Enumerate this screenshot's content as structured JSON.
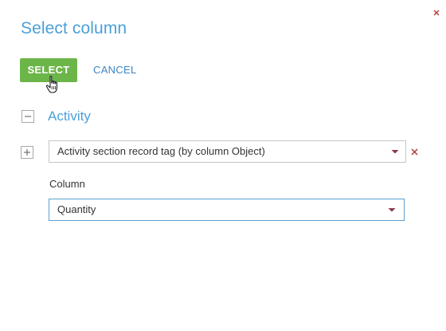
{
  "dialog": {
    "title": "Select column",
    "buttons": {
      "select_label": "SELECT",
      "cancel_label": "CANCEL"
    }
  },
  "group": {
    "label": "Activity",
    "collapse_icon": "minus-icon"
  },
  "lookup": {
    "expand_icon": "plus-icon",
    "value": "Activity section record tag (by column Object)",
    "remove_icon": "close-icon"
  },
  "column": {
    "label": "Column",
    "value": "Quantity"
  },
  "colors": {
    "accent_blue": "#4ba0d8",
    "link_blue": "#3f86c4",
    "select_green": "#6cb548",
    "remove_red": "#b03a3a",
    "focus_border": "#5aa0d0"
  }
}
